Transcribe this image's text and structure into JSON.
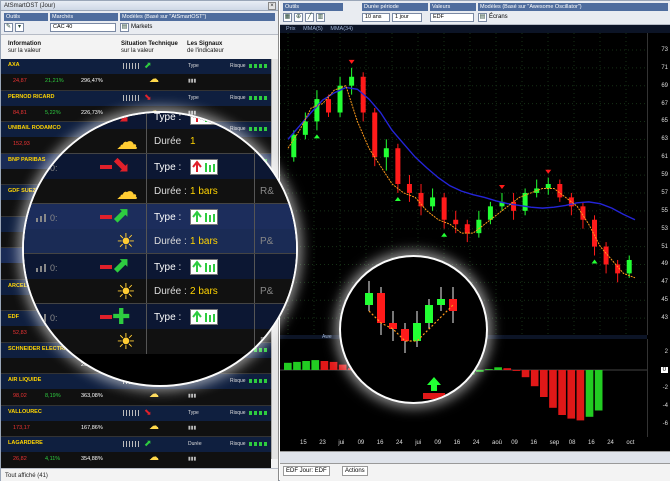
{
  "left": {
    "window_title": "AtSmartOST (Jour)",
    "toolbar": {
      "outils_label": "Outils",
      "marches_label": "Marchés",
      "marches_value": "CAC 40",
      "modeles_label": "Modèles (Basé sur \"AtSmartOST\")",
      "markets_label": "Markets"
    },
    "headers": {
      "info": "Information",
      "info_sub": "sur la valeur",
      "tech": "Situation Technique",
      "tech_sub": "sur la valeur",
      "sig": "Les Signaux",
      "sig_sub": "de l'indicateur"
    },
    "rows": [
      {
        "name": "AXA",
        "price": "24,87",
        "pct": "21,21%",
        "holding": "296,47%",
        "type": "Type",
        "risk": "Risque"
      },
      {
        "name": "PERNOD RICARD",
        "price": "84,81",
        "pct": "5,22%",
        "holding": "226,73%",
        "type": "Type",
        "risk": "Risque"
      },
      {
        "name": "UNIBAIL RODAMCO",
        "price": "152,93",
        "pct": "",
        "holding": "",
        "type": "Type",
        "risk": "Risque"
      },
      {
        "name": "BNP PARIBAS",
        "price": "",
        "pct": "",
        "holding": "",
        "type": "Type",
        "risk": "Risque"
      },
      {
        "name": "GDF SUEZ",
        "price": "",
        "pct": "",
        "holding": "",
        "type": "Type",
        "risk": "Risque"
      },
      {
        "name": "",
        "price": "",
        "pct": "",
        "holding": "",
        "type": "Type",
        "risk": "Risque"
      },
      {
        "name": "",
        "price": "",
        "pct": "",
        "holding": "",
        "type": "Type",
        "risk": "Risque"
      },
      {
        "name": "ARCELOR",
        "price": "",
        "pct": "",
        "holding": "",
        "type": "Type",
        "risk": "Risque"
      },
      {
        "name": "EDF",
        "price": "52,83",
        "pct": "",
        "holding": "",
        "type": "Type",
        "risk": "Risque"
      },
      {
        "name": "SCHNEIDER ELECTRIC",
        "price": "",
        "pct": "",
        "holding": "264,83%",
        "type": "Durée",
        "risk": "Risque"
      },
      {
        "name": "AIR LIQUIDE",
        "price": "98,02",
        "pct": "8,19%",
        "holding": "363,08%",
        "type": "Type",
        "risk": "Risque"
      },
      {
        "name": "VALLOUREC",
        "price": "173,17",
        "pct": "",
        "holding": "167,86%",
        "type": "Type",
        "risk": "Risque"
      },
      {
        "name": "LAGARDERE",
        "price": "26,82",
        "pct": "4,11%",
        "holding": "354,88%",
        "type": "Durée",
        "risk": "Risque"
      }
    ],
    "status": "Tout affiché (41)",
    "magnifier": {
      "rows": [
        {
          "label": "Durée",
          "value": "1",
          "type_label": "Type :"
        },
        {
          "label": "Durée :",
          "value": "1 bars",
          "type_label": "Type :"
        },
        {
          "label": "Durée :",
          "value": "1 bars",
          "type_label": "Type :"
        },
        {
          "label": "Durée :",
          "value": "2 bars",
          "type_label": "Type :"
        },
        {
          "label": "",
          "value": "",
          "type_label": "Type :"
        }
      ],
      "right_col": [
        "P&L",
        "R&",
        "P&",
        "P&"
      ]
    }
  },
  "right": {
    "toolbar": {
      "outils_label": "Outils",
      "periode_label": "Durée période",
      "periode_value": "10 ans",
      "periode_value2": "1 jour",
      "valeurs_label": "Valeurs",
      "valeurs_value": "EDF",
      "modeles_label": "Modèles (Basé sur \"Awesome Oscillator\")",
      "ecrans_label": "Écrans"
    },
    "chart_tabs": [
      "Prix",
      "MMA(5)",
      "MMA(34)"
    ],
    "ind_tab": "Awe",
    "bottom_tabs": [
      "EDF Jour: EDF",
      "Actions"
    ]
  },
  "chart_data": {
    "type": "line",
    "price_ticks": [
      "73",
      "71",
      "69",
      "67",
      "65",
      "63",
      "61",
      "59",
      "57",
      "55",
      "53",
      "51",
      "49",
      "47",
      "45",
      "43"
    ],
    "price_ylim": [
      42,
      74
    ],
    "ind_ticks": [
      "2",
      "0",
      "-2",
      "-4",
      "-6"
    ],
    "ind_ylim": [
      -7,
      3
    ],
    "time_labels": [
      "15",
      "23",
      "jui",
      "09",
      "16",
      "24",
      "jui",
      "09",
      "16",
      "24",
      "aoû",
      "09",
      "16",
      "sep",
      "08",
      "16",
      "24",
      "oct"
    ],
    "series": [
      {
        "name": "MMA(34)",
        "color": "#2424d8",
        "values": [
          63,
          64.5,
          66,
          67.4,
          68.2,
          68.8,
          68.6,
          67.5,
          66,
          64,
          62.5,
          61,
          59.8,
          58.7,
          57.8,
          57.2,
          56.8,
          56.5,
          56.1,
          55.8,
          55.6,
          55.4,
          55.3,
          55.4,
          55.6,
          55.9,
          56,
          55.8,
          55.3,
          54.6,
          54
        ]
      },
      {
        "name": "MMA(5)",
        "color": "#ff9a1a",
        "values": [
          62,
          64,
          66.5,
          67,
          68.5,
          69,
          65,
          62,
          60,
          58,
          57,
          56.5,
          55,
          54,
          53.5,
          52.5,
          52.5,
          53.5,
          54.5,
          55.5,
          56.5,
          57,
          57.5,
          57.5,
          56.5,
          55.5,
          53.5,
          51,
          49.5,
          48,
          47.5
        ]
      }
    ],
    "candles": [
      {
        "o": 61,
        "c": 63.5,
        "h": 64,
        "l": 60.5
      },
      {
        "o": 63.5,
        "c": 65,
        "h": 66,
        "l": 63
      },
      {
        "o": 65,
        "c": 67.5,
        "h": 68.5,
        "l": 64
      },
      {
        "o": 67.5,
        "c": 66,
        "h": 68,
        "l": 65.5
      },
      {
        "o": 66,
        "c": 69,
        "h": 70,
        "l": 65.5
      },
      {
        "o": 69,
        "c": 70,
        "h": 71,
        "l": 68
      },
      {
        "o": 70,
        "c": 66,
        "h": 70.5,
        "l": 65
      },
      {
        "o": 66,
        "c": 61,
        "h": 66.5,
        "l": 60
      },
      {
        "o": 61,
        "c": 62,
        "h": 63,
        "l": 59.5
      },
      {
        "o": 62,
        "c": 58,
        "h": 62.5,
        "l": 57
      },
      {
        "o": 58,
        "c": 57,
        "h": 59,
        "l": 56
      },
      {
        "o": 57,
        "c": 55.5,
        "h": 58,
        "l": 54.5
      },
      {
        "o": 55.5,
        "c": 56.5,
        "h": 57.5,
        "l": 55
      },
      {
        "o": 56.5,
        "c": 54,
        "h": 57,
        "l": 53
      },
      {
        "o": 54,
        "c": 53.5,
        "h": 55,
        "l": 52.5
      },
      {
        "o": 53.5,
        "c": 52.5,
        "h": 54,
        "l": 51.5
      },
      {
        "o": 52.5,
        "c": 54,
        "h": 55,
        "l": 52
      },
      {
        "o": 54,
        "c": 55.5,
        "h": 56,
        "l": 53.5
      },
      {
        "o": 55.5,
        "c": 56,
        "h": 57,
        "l": 55
      },
      {
        "o": 56,
        "c": 55,
        "h": 57,
        "l": 54
      },
      {
        "o": 55,
        "c": 57,
        "h": 57.5,
        "l": 54.5
      },
      {
        "o": 57,
        "c": 57.5,
        "h": 58.5,
        "l": 56.5
      },
      {
        "o": 57.5,
        "c": 58,
        "h": 58.7,
        "l": 56.8
      },
      {
        "o": 58,
        "c": 56.5,
        "h": 58.5,
        "l": 56
      },
      {
        "o": 56.5,
        "c": 55.5,
        "h": 57,
        "l": 54.5
      },
      {
        "o": 55.5,
        "c": 54,
        "h": 56,
        "l": 53
      },
      {
        "o": 54,
        "c": 51,
        "h": 54.5,
        "l": 50
      },
      {
        "o": 51,
        "c": 49,
        "h": 51.5,
        "l": 48
      },
      {
        "o": 49,
        "c": 48,
        "h": 49.5,
        "l": 47
      },
      {
        "o": 48,
        "c": 49.5,
        "h": 50,
        "l": 47.5
      }
    ],
    "oscillator": [
      0.8,
      0.9,
      1.0,
      1.1,
      1.0,
      0.9,
      0.6,
      0.2,
      -0.5,
      -1.2,
      -1.8,
      -2.3,
      -2.6,
      -2.8,
      -2.6,
      -2.3,
      -2.0,
      -1.6,
      -1.2,
      -0.8,
      -0.5,
      -0.2,
      0.1,
      0.3,
      0.2,
      -0.1,
      -0.8,
      -1.8,
      -3.0,
      -4.2,
      -5.0,
      -5.4,
      -5.6,
      -5.2,
      -4.5
    ]
  }
}
